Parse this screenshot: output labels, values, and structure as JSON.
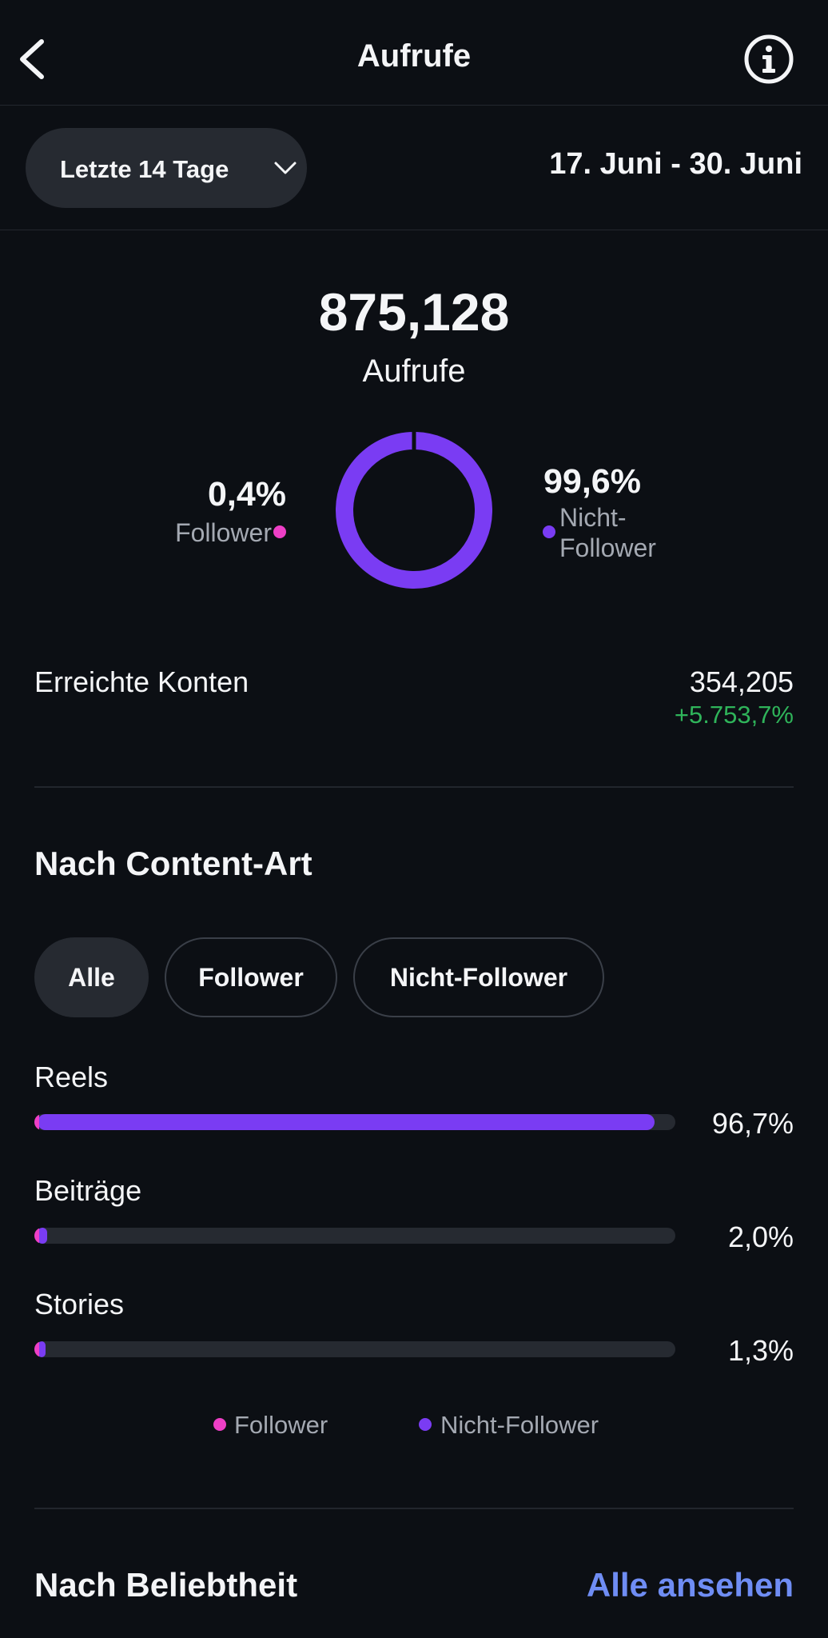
{
  "header": {
    "title": "Aufrufe",
    "back_icon": "chevron-left-icon",
    "info_icon": "info-icon"
  },
  "filter": {
    "range_label": "Letzte 14 Tage",
    "date_range": "17. Juni - 30. Juni"
  },
  "overview": {
    "total": "875,128",
    "total_label": "Aufrufe",
    "follower_pct": "0,4%",
    "follower_label": "Follower",
    "non_follower_pct": "99,6%",
    "non_follower_label_line1": "Nicht-",
    "non_follower_label_line2": "Follower",
    "follower_share": 0.004,
    "colors": {
      "follower": "#ee3fc6",
      "non_follower": "#7a3cf3"
    }
  },
  "reach": {
    "label": "Erreichte Konten",
    "value": "354,205",
    "change": "+5.753,7%"
  },
  "content_type": {
    "title": "Nach Content-Art",
    "chips": [
      "Alle",
      "Follower",
      "Nicht-Follower"
    ],
    "rows": [
      {
        "label": "Reels",
        "pct": "96,7%",
        "share": 0.967
      },
      {
        "label": "Beiträge",
        "pct": "2,0%",
        "share": 0.02
      },
      {
        "label": "Stories",
        "pct": "1,3%",
        "share": 0.013
      }
    ],
    "legend": [
      "Follower",
      "Nicht-Follower"
    ]
  },
  "popularity": {
    "title": "Nach Beliebtheit",
    "see_all": "Alle ansehen"
  }
}
